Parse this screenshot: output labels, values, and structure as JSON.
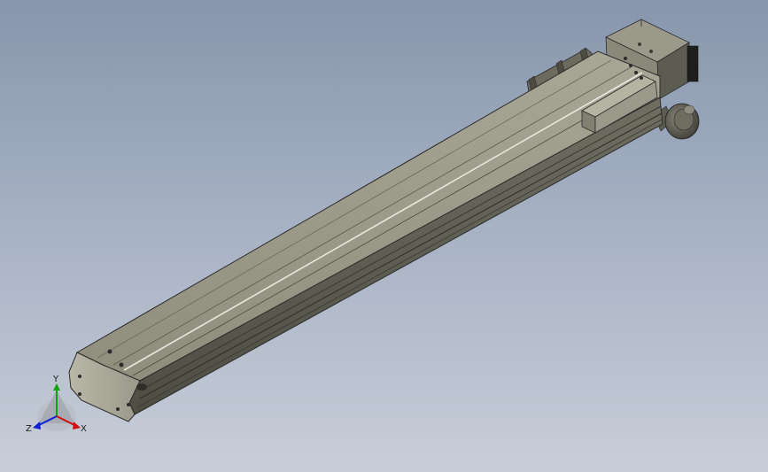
{
  "viewport": {
    "background_top": "#8796ad",
    "background_bottom": "#c8ced9"
  },
  "model": {
    "type": "linear-actuator",
    "body_color": "#8f8e7e",
    "edge_color": "#2b2b2b"
  },
  "triad": {
    "x_label": "X",
    "y_label": "Y",
    "z_label": "Z",
    "x_color": "#d01010",
    "y_color": "#10a010",
    "z_color": "#1020d0"
  }
}
